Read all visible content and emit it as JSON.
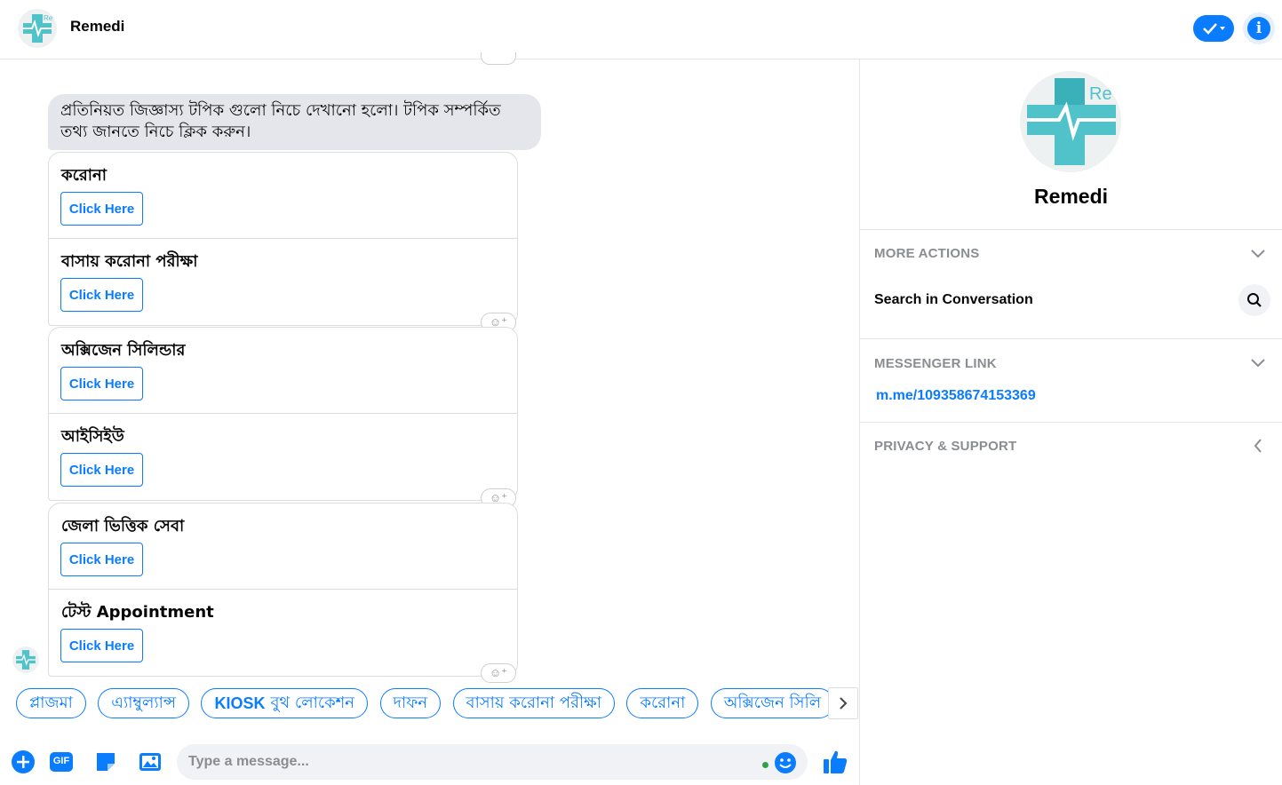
{
  "header": {
    "title": "Remedi",
    "logo_icon": "remedi-logo-icon",
    "check_icon": "checkmark-dropdown-icon",
    "info_icon": "info-icon"
  },
  "colors": {
    "accent": "#0a7cff",
    "bubble_bg": "#e4e6eb",
    "online": "#31a24c",
    "logo_teal": "#4fc3c9"
  },
  "chat": {
    "intro_message": "প্রতিনিয়ত জিজ্ঞাস্য টপিক গুলো নিচে দেখানো হলো। টপিক সম্পর্কিত তথ্য জানতে নিচে ক্লিক করুন।",
    "cards": [
      {
        "items": [
          {
            "title": "করোনা",
            "button": "Click Here"
          },
          {
            "title": "বাসায় করোনা পরীক্ষা",
            "button": "Click Here"
          }
        ]
      },
      {
        "items": [
          {
            "title": "অক্সিজেন সিলিন্ডার",
            "button": "Click Here"
          },
          {
            "title": "আইসিইউ",
            "button": "Click Here"
          }
        ]
      },
      {
        "items": [
          {
            "title": "জেলা ভিত্তিক সেবা",
            "button": "Click Here"
          },
          {
            "title": "টেস্ট Appointment",
            "button": "Click Here"
          }
        ]
      }
    ],
    "react_icon": "add-reaction-icon"
  },
  "quick_replies": {
    "items": [
      "প্লাজমা",
      "এ্যাম্বুল্যান্স",
      "বুথ লোকেশন",
      "দাফন",
      "বাসায় করোনা পরীক্ষা",
      "করোনা",
      "অক্সিজেন সিলি"
    ],
    "kiosk_prefix": "KIOSK",
    "next_icon": "chevron-right-icon"
  },
  "composer": {
    "placeholder": "Type a message...",
    "add_icon": "plus-circle-icon",
    "gif_label": "GIF",
    "sticker_icon": "sticker-icon",
    "image_icon": "image-icon",
    "emoji_icon": "emoji-icon",
    "like_icon": "thumbs-up-icon"
  },
  "sidebar": {
    "name": "Remedi",
    "more_actions_title": "MORE ACTIONS",
    "search_label": "Search in Conversation",
    "messenger_link_title": "MESSENGER LINK",
    "messenger_link": "m.me/109358674153369",
    "privacy_title": "PRIVACY & SUPPORT"
  }
}
